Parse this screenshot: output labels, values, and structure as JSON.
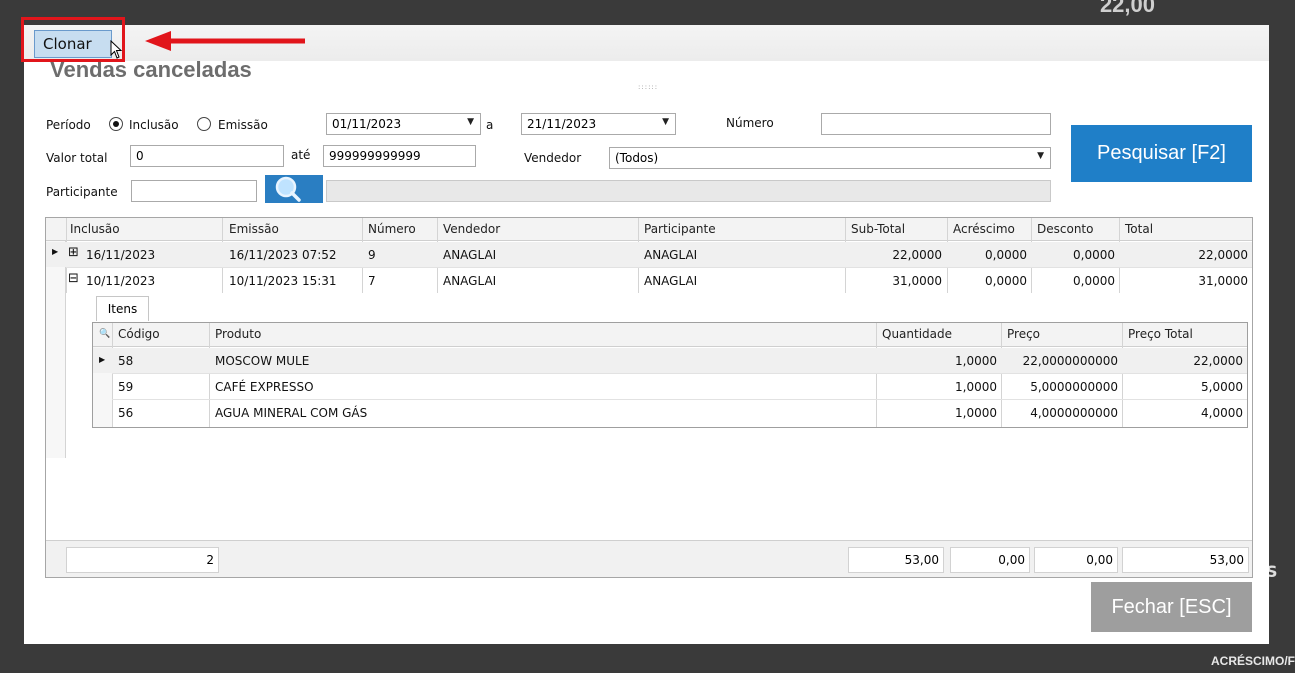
{
  "background": {
    "total_value": "22,00",
    "bottom_label": "ACRÉSCIMO/F",
    "side_text": "S"
  },
  "toolbar": {
    "clone_label": "Clonar"
  },
  "page": {
    "title": "Vendas canceladas",
    "grip": "::::::"
  },
  "filters": {
    "period_label": "Período",
    "radio_inclusion": "Inclusão",
    "radio_emission": "Emissão",
    "selected_radio": "Inclusão",
    "date_from": "01/11/2023",
    "a_label": "a",
    "date_to": "21/11/2023",
    "number_label": "Número",
    "number_value": "",
    "total_label": "Valor total",
    "total_from": "0",
    "ate_label": "até",
    "total_to": "999999999999",
    "seller_label": "Vendedor",
    "seller_value": "(Todos)",
    "participant_label": "Participante",
    "participant_value": "",
    "participant_name": ""
  },
  "buttons": {
    "search": "Pesquisar [F2]",
    "close": "Fechar [ESC]"
  },
  "grid": {
    "columns": [
      "Inclusão",
      "Emissão",
      "Número",
      "Vendedor",
      "Participante",
      "Sub-Total",
      "Acréscimo",
      "Desconto",
      "Total"
    ],
    "rows": [
      {
        "inclusao": "16/11/2023",
        "emissao": "16/11/2023 07:52",
        "numero": "9",
        "vendedor": "ANAGLAI",
        "participante": "ANAGLAI",
        "subtotal": "22,0000",
        "acrescimo": "0,0000",
        "desconto": "0,0000",
        "total": "22,0000",
        "expander": "⊞"
      },
      {
        "inclusao": "10/11/2023",
        "emissao": "10/11/2023 15:31",
        "numero": "7",
        "vendedor": "ANAGLAI",
        "participante": "ANAGLAI",
        "subtotal": "31,0000",
        "acrescimo": "0,0000",
        "desconto": "0,0000",
        "total": "31,0000",
        "expander": "⊟"
      }
    ],
    "detail_tab": "Itens",
    "detail_columns": [
      "Código",
      "Produto",
      "Quantidade",
      "Preço",
      "Preço Total"
    ],
    "detail_rows": [
      {
        "codigo": "58",
        "produto": "MOSCOW MULE",
        "quantidade": "1,0000",
        "preco": "22,0000000000",
        "preco_total": "22,0000"
      },
      {
        "codigo": "59",
        "produto": "CAFÉ EXPRESSO",
        "quantidade": "1,0000",
        "preco": "5,0000000000",
        "preco_total": "5,0000"
      },
      {
        "codigo": "56",
        "produto": "AGUA MINERAL COM GÁS",
        "quantidade": "1,0000",
        "preco": "4,0000000000",
        "preco_total": "4,0000"
      }
    ],
    "footer": {
      "count": "2",
      "subtotal": "53,00",
      "acrescimo": "0,00",
      "desconto": "0,00",
      "total": "53,00"
    }
  },
  "colors": {
    "accent_blue": "#1f7fc8",
    "highlight_red": "#e1151b",
    "disabled_gray": "#9e9e9e"
  }
}
